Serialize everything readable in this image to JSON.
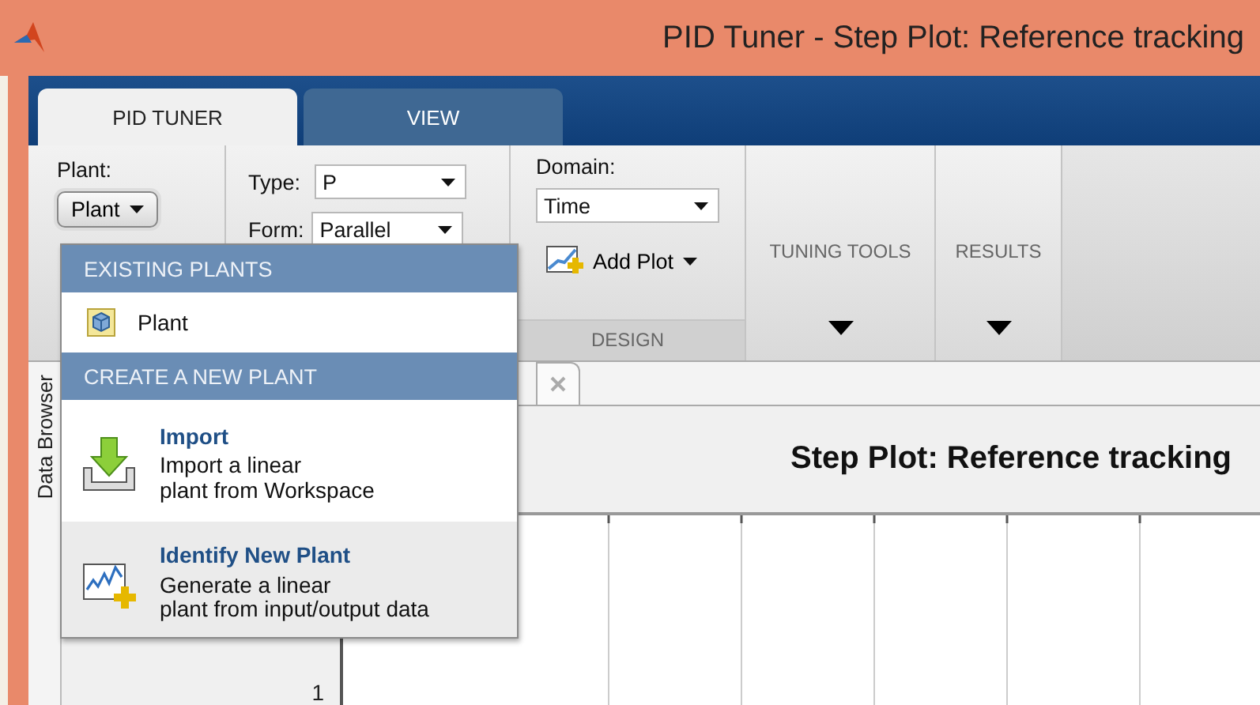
{
  "window": {
    "title": "PID Tuner - Step Plot: Reference tracking"
  },
  "tabs": [
    {
      "label": "PID TUNER",
      "selected": true
    },
    {
      "label": "VIEW",
      "selected": false
    }
  ],
  "ribbon": {
    "plant_label": "Plant:",
    "plant_button": "Plant",
    "type_label": "Type:",
    "type_value": "P",
    "form_label": "Form:",
    "form_value": "Parallel",
    "domain_label": "Domain:",
    "domain_value": "Time",
    "add_plot": "Add Plot",
    "design_label": "DESIGN",
    "tuning_tools": "TUNING TOOLS",
    "results": "RESULTS"
  },
  "plant_menu": {
    "sections": [
      {
        "header": "EXISTING PLANTS",
        "items": [
          {
            "kind": "plant",
            "title": "Plant",
            "selected": false
          }
        ]
      },
      {
        "header": "CREATE A NEW PLANT",
        "items": [
          {
            "kind": "import",
            "title": "Import",
            "lines": [
              "Import a linear",
              "plant from Workspace"
            ],
            "selected": false
          },
          {
            "kind": "identify",
            "title": "Identify New Plant",
            "lines": [
              "Generate a linear",
              "plant from input/output data"
            ],
            "selected": true
          }
        ]
      }
    ]
  },
  "data_browser": {
    "label": "Data Browser"
  },
  "plot": {
    "title": "Step Plot: Reference tracking",
    "y_tick": "1"
  }
}
